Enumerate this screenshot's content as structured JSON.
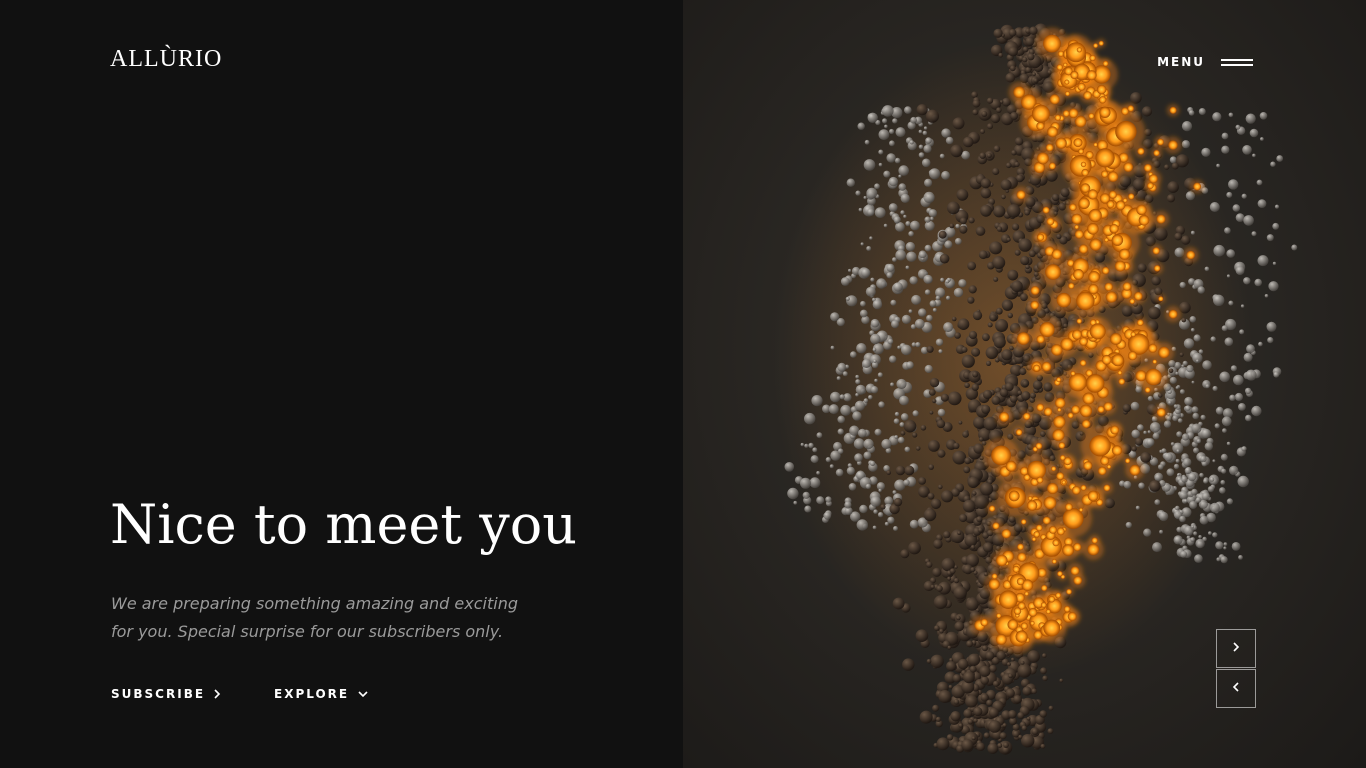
{
  "brand": {
    "logo_text": "ALLÙRIO"
  },
  "header": {
    "menu_label": "MENU"
  },
  "hero": {
    "title": "Nice to meet you",
    "subtitle": "We are preparing something amazing and exciting for you. Special surprise for our subscribers only."
  },
  "actions": {
    "subscribe_label": "SUBSCRIBE",
    "explore_label": "EXPLORE"
  },
  "icons": {
    "menu": "hamburger-icon",
    "subscribe": "chevron-right-icon",
    "explore": "chevron-down-icon",
    "next": "chevron-right-icon",
    "prev": "chevron-left-icon"
  },
  "colors": {
    "left_background": "#111111",
    "text_primary": "#ffffff",
    "text_muted": "#9a9a9a",
    "glow_orange": "#ff9a1a",
    "glow_yellow": "#ffd24a"
  }
}
